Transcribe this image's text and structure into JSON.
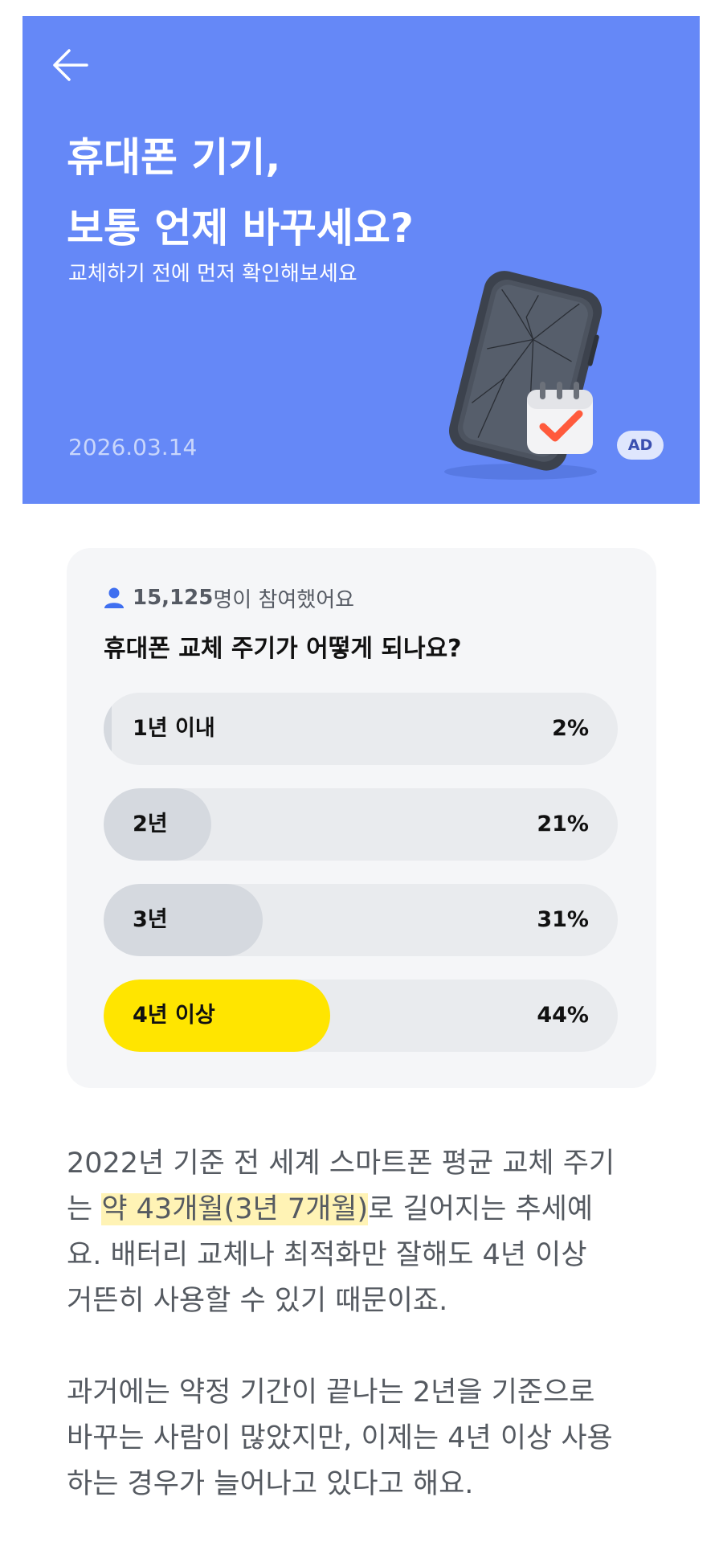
{
  "hero": {
    "back_label": "←",
    "title_line1": "휴대폰 기기,",
    "title_line2": "보통 언제 바꾸세요?",
    "subtitle": "교체하기 전에 먼저 확인해보세요",
    "date": "2026.03.14",
    "ad_badge": "AD",
    "background_color": "#6588f7",
    "illustration": "cracked-phone-with-calendar-check"
  },
  "poll": {
    "participants_count": "15,125",
    "participants_suffix": "명이 참여했어요",
    "question": "휴대폰 교체 주기가 어떻게 되나요?",
    "options": [
      {
        "label": "1년 이내",
        "percent_text": "2%",
        "percent": 2,
        "selected": false
      },
      {
        "label": "2년",
        "percent_text": "21%",
        "percent": 21,
        "selected": false
      },
      {
        "label": "3년",
        "percent_text": "31%",
        "percent": 31,
        "selected": false
      },
      {
        "label": "4년 이상",
        "percent_text": "44%",
        "percent": 44,
        "selected": true
      }
    ],
    "winner_color": "#ffe500"
  },
  "article": {
    "p1_line1": "2022년 기준 전 세계 스마트폰 평균 교체 주기",
    "p1_line2_before": "는 ",
    "p1_line2_highlight": "약 43개월(3년 7개월)",
    "p1_line2_after": "로 길어지는 추세예",
    "p1_line3": "요. 배터리 교체나 최적화만 잘해도 4년 이상",
    "p1_line4": "거뜬히 사용할 수 있기 때문이죠.",
    "p2_line1": "과거에는 약정 기간이 끝나는 2년을 기준으로",
    "p2_line2": "바꾸는 사람이 많았지만, 이제는 4년 이상 사용",
    "p2_line3": "하는 경우가 늘어나고 있다고 해요.",
    "highlight_color": "#fff3b5"
  }
}
